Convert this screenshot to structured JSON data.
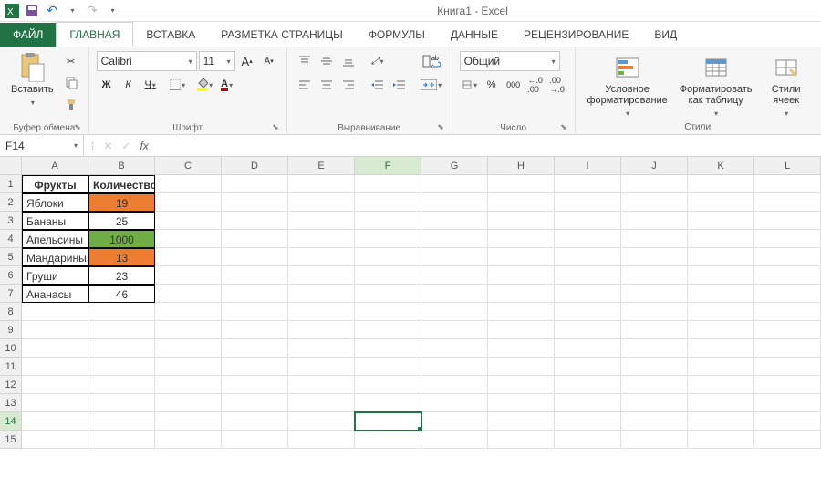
{
  "title": "Книга1 - Excel",
  "tabs": {
    "file": "ФАЙЛ",
    "home": "ГЛАВНАЯ",
    "insert": "ВСТАВКА",
    "pagelayout": "РАЗМЕТКА СТРАНИЦЫ",
    "formulas": "ФОРМУЛЫ",
    "data": "ДАННЫЕ",
    "review": "РЕЦЕНЗИРОВАНИЕ",
    "view": "ВИД"
  },
  "ribbon": {
    "clipboard": {
      "label": "Буфер обмена",
      "paste": "Вставить"
    },
    "font": {
      "label": "Шрифт",
      "name": "Calibri",
      "size": "11",
      "bold": "Ж",
      "italic": "К",
      "underline": "Ч",
      "incA": "A",
      "decA": "A"
    },
    "alignment": {
      "label": "Выравнивание"
    },
    "number": {
      "label": "Число",
      "format": "Общий",
      "pct": "%",
      "sep": "000"
    },
    "styles": {
      "label": "Стили",
      "condfmt": "Условное форматирование",
      "table": "Форматировать как таблицу",
      "cell": "Стили ячеек"
    }
  },
  "namebox": "F14",
  "formula": "",
  "columns": [
    "A",
    "B",
    "C",
    "D",
    "E",
    "F",
    "G",
    "H",
    "I",
    "J",
    "K",
    "L"
  ],
  "rows": [
    "1",
    "2",
    "3",
    "4",
    "5",
    "6",
    "7",
    "8",
    "9",
    "10",
    "11",
    "12",
    "13",
    "14",
    "15"
  ],
  "sheet": {
    "A1": "Фрукты",
    "B1": "Количество, кг",
    "A2": "Яблоки",
    "B2": "19",
    "A3": "Бананы",
    "B3": "25",
    "A4": "Апельсины",
    "B4": "1000",
    "A5": "Мандарины",
    "B5": "13",
    "A6": "Груши",
    "B6": "23",
    "A7": "Ананасы",
    "B7": "46"
  },
  "selected_cell": "F14"
}
